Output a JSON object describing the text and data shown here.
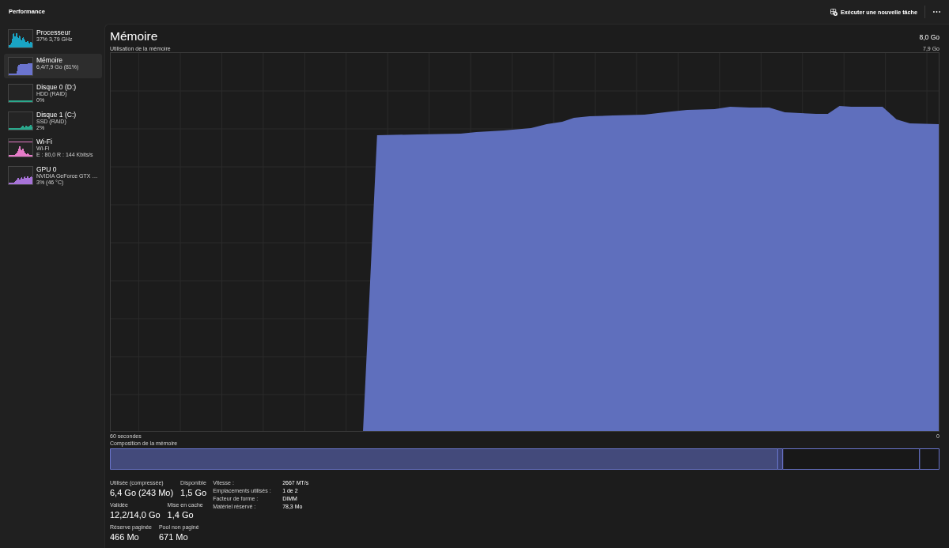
{
  "header": {
    "title": "Performance",
    "run_task_button": "Exécuter une nouvelle tâche"
  },
  "sidebar": {
    "items": [
      {
        "name": "Processeur",
        "details": [
          "37% 3,79 GHz"
        ],
        "color": "#19a4c4",
        "selected": false
      },
      {
        "name": "Mémoire",
        "details": [
          "6,4/7,9 Go (81%)"
        ],
        "color": "#6b74cf",
        "selected": true
      },
      {
        "name": "Disque 0 (D:)",
        "details": [
          "HDD (RAID)",
          "0%"
        ],
        "color": "#2aa88c",
        "selected": false
      },
      {
        "name": "Disque 1 (C:)",
        "details": [
          "SSD (RAID)",
          "2%"
        ],
        "color": "#2aa88c",
        "selected": false
      },
      {
        "name": "Wi-Fi",
        "details": [
          "Wi-Fi",
          "E : 80,0 R : 144 Kbits/s"
        ],
        "color": "#e67cc8",
        "selected": false
      },
      {
        "name": "GPU 0",
        "details": [
          "NVIDIA GeForce GTX …",
          "3% (46 °C)"
        ],
        "color": "#a773d8",
        "selected": false
      }
    ]
  },
  "panel": {
    "title": "Mémoire",
    "capacity": "8,0 Go",
    "chart_subtitle": "Utilisation de la mémoire",
    "chart_max_label": "7,9 Go",
    "time_start_label": "60 secondes",
    "time_end_label": "0",
    "composition_title": "Composition de la mémoire",
    "stat_rows": [
      [
        {
          "label": "Utilisée (compressée)",
          "value": "6,4 Go (243 Mo)"
        },
        {
          "label": "Disponible",
          "value": "1,5 Go"
        }
      ],
      [
        {
          "label": "Validée",
          "value": "12,2/14,0 Go"
        },
        {
          "label": "Mise en cache",
          "value": "1,4 Go"
        }
      ],
      [
        {
          "label": "Réserve paginée",
          "value": "466 Mo"
        },
        {
          "label": "Pool non paginé",
          "value": "671 Mo"
        }
      ]
    ],
    "specs": [
      {
        "label": "Vitesse :",
        "value": "2667 MT/s"
      },
      {
        "label": "Emplacements utilisés :",
        "value": "1 de 2"
      },
      {
        "label": "Facteur de forme :",
        "value": "DIMM"
      },
      {
        "label": "Matériel réservé :",
        "value": "78,3 Mo"
      }
    ]
  }
}
